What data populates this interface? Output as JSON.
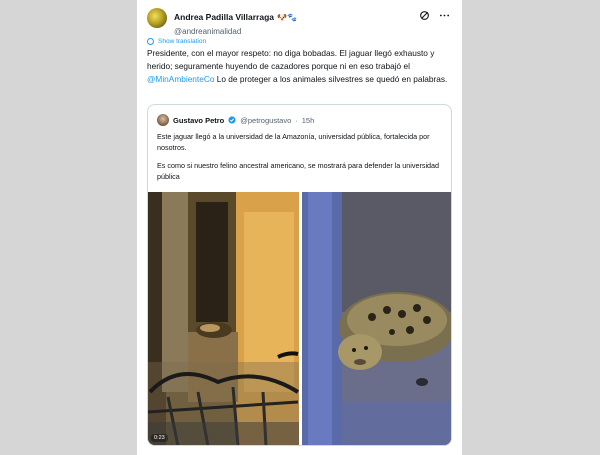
{
  "tweet": {
    "display_name": "Andrea Padilla Villarraga",
    "emoji": "🐶🐾",
    "handle": "@andreanimalidad",
    "translate_label": "Show translation",
    "text_part1": "Presidente, con el mayor respeto: no diga bobadas. El jaguar llegó exhausto y herido; seguramente huyendo de cazadores porque ni en eso trabajó el ",
    "mention": "@MinAmbienteCo",
    "text_part2": " Lo de proteger a los animales silvestres se quedó en palabras."
  },
  "quote": {
    "display_name": "Gustavo Petro",
    "handle": "@petrogustavo",
    "separator": "·",
    "time": "15h",
    "paragraph1": "Este jaguar llegó a la universidad de la Amazonía, universidad pública, fortalecida por nosotros.",
    "paragraph2": "Es como si nuestro felino ancestral americano, se mostrará para defender la universidad pública",
    "video_timestamp": "0:23"
  },
  "icons": {
    "grok": "grok-icon",
    "more": "more-icon",
    "translate": "globe-icon"
  },
  "colors": {
    "accent": "#1d9bf0",
    "text": "#0f1419",
    "muted": "#536471",
    "border": "#cfd9de"
  }
}
